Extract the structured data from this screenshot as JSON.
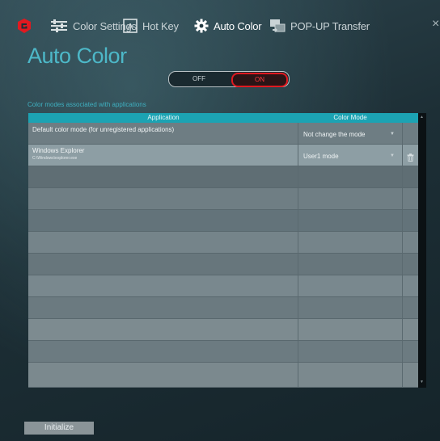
{
  "tabs": [
    {
      "label": "Color Settings",
      "icon": "sliders-icon"
    },
    {
      "label": "Hot Key",
      "icon": "keyboard-a-icon"
    },
    {
      "label": "Auto Color",
      "icon": "gear-icon"
    },
    {
      "label": "POP-UP Transfer",
      "icon": "transfer-icon"
    }
  ],
  "active_tab": "Auto Color",
  "close_glyph": "×",
  "page_title": "Auto Color",
  "toggle": {
    "off_label": "OFF",
    "on_label": "ON",
    "state": "ON"
  },
  "section_label": "Color modes associated with applications",
  "table": {
    "columns": [
      "Application",
      "Color Mode"
    ],
    "rows": [
      {
        "app": "Default color mode (for unregistered applications)",
        "path": "",
        "mode": "Not change the mode"
      },
      {
        "app": "Windows Explorer",
        "path": "C:\\Windows\\explorer.exe",
        "mode": "User1 mode"
      }
    ],
    "empty_rows": 10
  },
  "initialize_label": "Initialize",
  "colors": {
    "accent": "#1ca3b3",
    "title": "#4db8c8",
    "toggle_on": "#e11920",
    "brand": "#e11920"
  }
}
